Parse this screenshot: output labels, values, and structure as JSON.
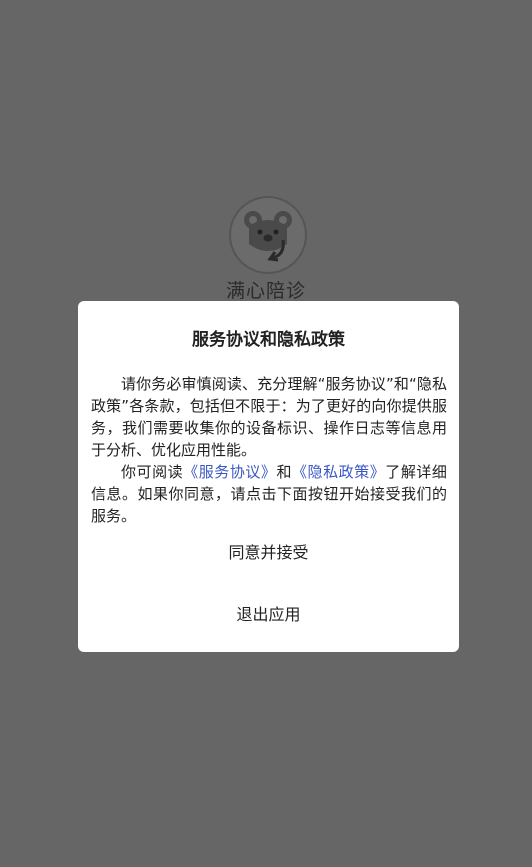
{
  "app": {
    "name": "满心陪诊"
  },
  "dialog": {
    "title": "服务协议和隐私政策",
    "paragraph1": "请你务必审慎阅读、充分理解“服务协议”和“隐私政策”各条款，包括但不限于：为了更好的向你提供服务，我们需要收集你的设备标识、操作日志等信息用于分析、优化应用性能。",
    "paragraph2_prefix": "你可阅读",
    "link_service": "《服务协议》",
    "paragraph2_and": "和",
    "link_privacy": "《隐私政策》",
    "paragraph2_suffix": "了解详细信息。如果你同意，请点击下面按钮开始接受我们的服务。",
    "agree_label": "同意并接受",
    "exit_label": "退出应用"
  },
  "colors": {
    "overlay": "#666666",
    "dialog_bg": "#ffffff",
    "link": "#3b57c4"
  },
  "icons": {
    "logo": "koala-logo-icon"
  }
}
